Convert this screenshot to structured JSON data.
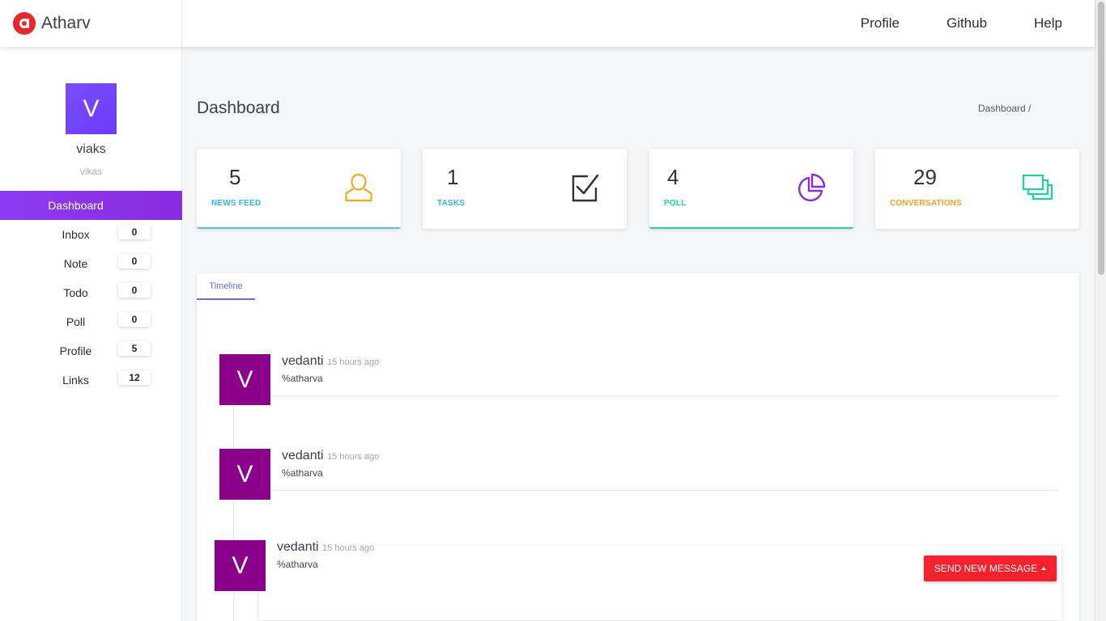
{
  "brand": {
    "name": "Atharv",
    "logo_icon": "atharv-logo-icon",
    "accent": "#e9262b"
  },
  "topnav": {
    "items": [
      "Profile",
      "Github",
      "Help"
    ]
  },
  "user": {
    "avatar_letter": "V",
    "name": "viaks",
    "handle": "vikas"
  },
  "sidebar": {
    "active_color": "#8a2be2",
    "items": [
      {
        "label": "Dashboard",
        "count": null
      },
      {
        "label": "Inbox",
        "count": "0"
      },
      {
        "label": "Note",
        "count": "0"
      },
      {
        "label": "Todo",
        "count": "0"
      },
      {
        "label": "Poll",
        "count": "0"
      },
      {
        "label": "Profile",
        "count": "5"
      },
      {
        "label": "Links",
        "count": "12"
      }
    ]
  },
  "page": {
    "title": "Dashboard",
    "breadcrumb": "Dashboard /"
  },
  "stats": [
    {
      "value": "5",
      "label": "NEWS FEED",
      "icon": "user-icon",
      "color": "#5bc0de",
      "icon_color": "#f5a623"
    },
    {
      "value": "1",
      "label": "TASKS",
      "icon": "checkbox-icon",
      "color": "#2fb5d6",
      "icon_color": "#333"
    },
    {
      "value": "4",
      "label": "POLL",
      "icon": "pie-chart-icon",
      "color": "#1dd1a1",
      "icon_color": "#8a2be2"
    },
    {
      "value": "29",
      "label": "CONVERSATIONS",
      "icon": "chat-windows-icon",
      "color": "#f0a020",
      "icon_color": "#1dd1a1"
    }
  ],
  "timeline": {
    "tab_label": "Timeline",
    "entries": [
      {
        "avatar_letter": "V",
        "name": "vedanti",
        "time": "15 hours ago",
        "message": "%atharva"
      },
      {
        "avatar_letter": "V",
        "name": "vedanti",
        "time": "15 hours ago",
        "message": "%atharva"
      },
      {
        "avatar_letter": "V",
        "name": "vedanti",
        "time": "15 hours ago",
        "message": "%atharva"
      }
    ]
  },
  "actions": {
    "send_label": "SEND NEW MESSAGE"
  }
}
